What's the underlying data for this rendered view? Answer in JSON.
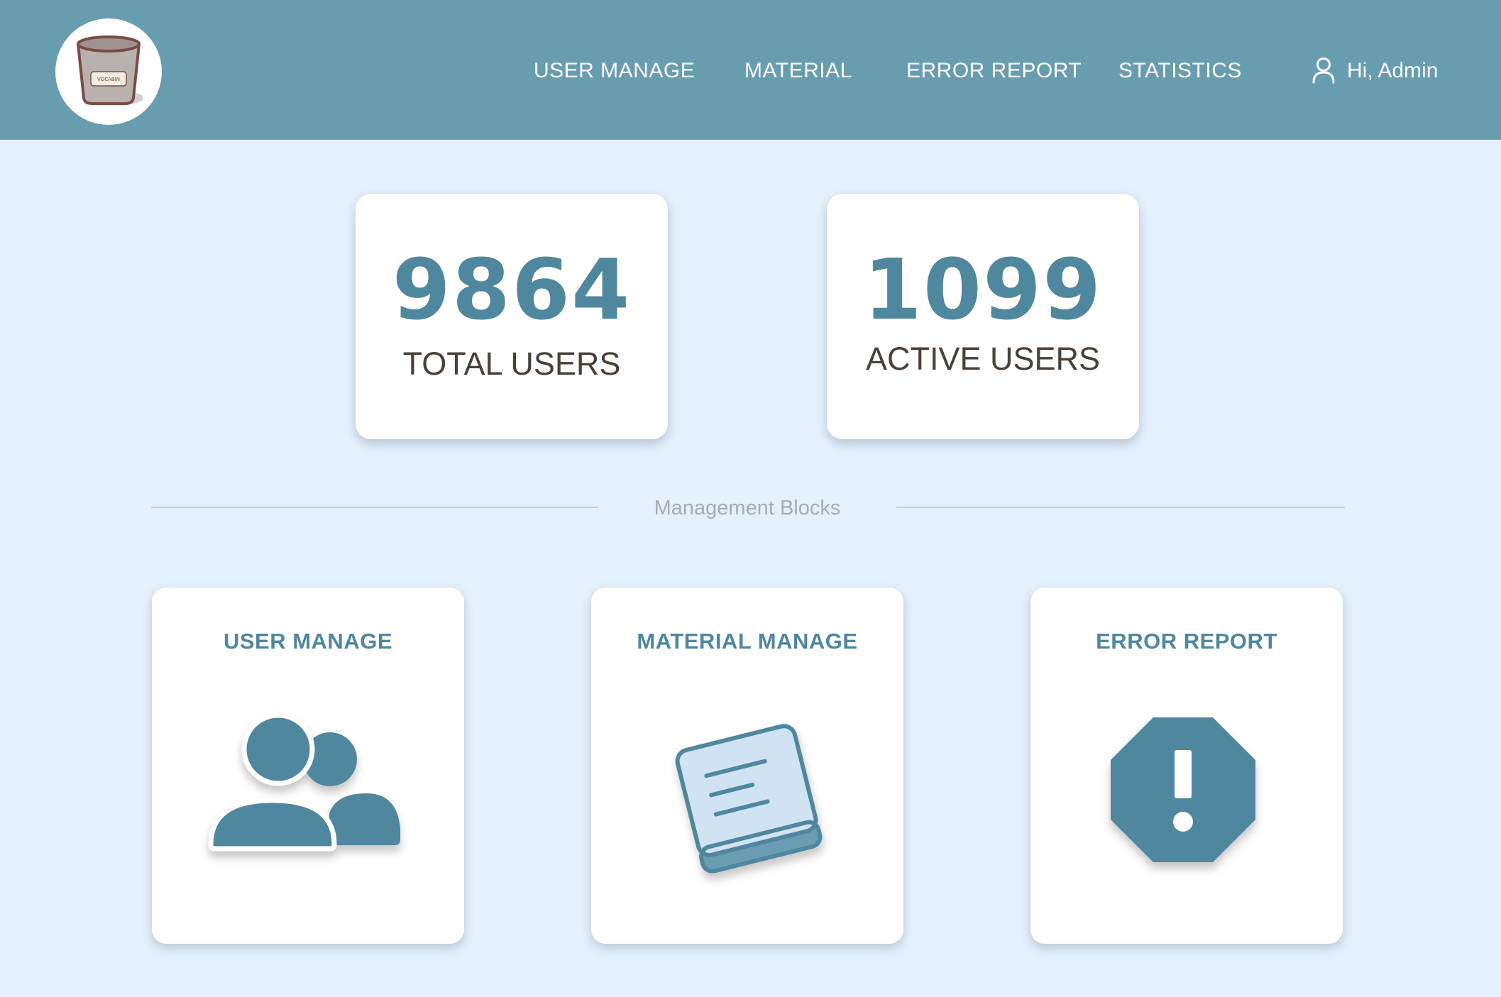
{
  "header": {
    "logo_text": "VOCABIN",
    "nav": [
      {
        "label": "USER MANAGE"
      },
      {
        "label": "MATERIAL"
      },
      {
        "label": "ERROR REPORT"
      },
      {
        "label": "STATISTICS"
      }
    ],
    "user_greeting": "Hi, Admin",
    "user_icon": "user-icon",
    "background_color": "#689db0"
  },
  "stats": [
    {
      "value": "9864",
      "label": "TOTAL USERS"
    },
    {
      "value": "1099",
      "label": "ACTIVE USERS"
    }
  ],
  "divider": {
    "label": "Management Blocks"
  },
  "blocks": [
    {
      "title": "USER MANAGE",
      "icon": "users-icon"
    },
    {
      "title": "MATERIAL MANAGE",
      "icon": "book-icon"
    },
    {
      "title": "ERROR REPORT",
      "icon": "warning-octagon-icon"
    }
  ],
  "colors": {
    "accent": "#4f879e",
    "page_background": "#e4f0fc",
    "card_background": "#ffffff",
    "stat_label": "#4a4038"
  }
}
